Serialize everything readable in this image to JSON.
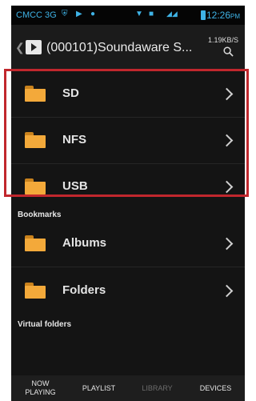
{
  "status_bar": {
    "carrier": "CMCC 3G",
    "time": "12:26",
    "ampm": "PM"
  },
  "action_bar": {
    "title": "(000101)Soundaware S...",
    "rate": "1.19KB/S",
    "icons": [
      "back-icon",
      "app-icon",
      "search-icon"
    ]
  },
  "sources": [
    {
      "label": "SD",
      "icon": "folder-icon"
    },
    {
      "label": "NFS",
      "icon": "folder-icon"
    },
    {
      "label": "USB",
      "icon": "folder-icon"
    }
  ],
  "bookmarks": {
    "header": "Bookmarks",
    "items": [
      {
        "label": "Albums",
        "icon": "folder-icon"
      },
      {
        "label": "Folders",
        "icon": "folder-icon"
      }
    ]
  },
  "virtual_folders": {
    "header": "Virtual folders"
  },
  "tabs": [
    {
      "line1": "NOW",
      "line2": "PLAYING",
      "active": true
    },
    {
      "line1": "PLAYLIST",
      "line2": "",
      "active": true
    },
    {
      "line1": "LIBRARY",
      "line2": "",
      "active": false
    },
    {
      "line1": "DEVICES",
      "line2": "",
      "active": true
    }
  ],
  "colors": {
    "background": "#141414",
    "status_text": "#3fb3e6",
    "folder": "#f3a93a",
    "highlight_border": "#c1272d"
  }
}
